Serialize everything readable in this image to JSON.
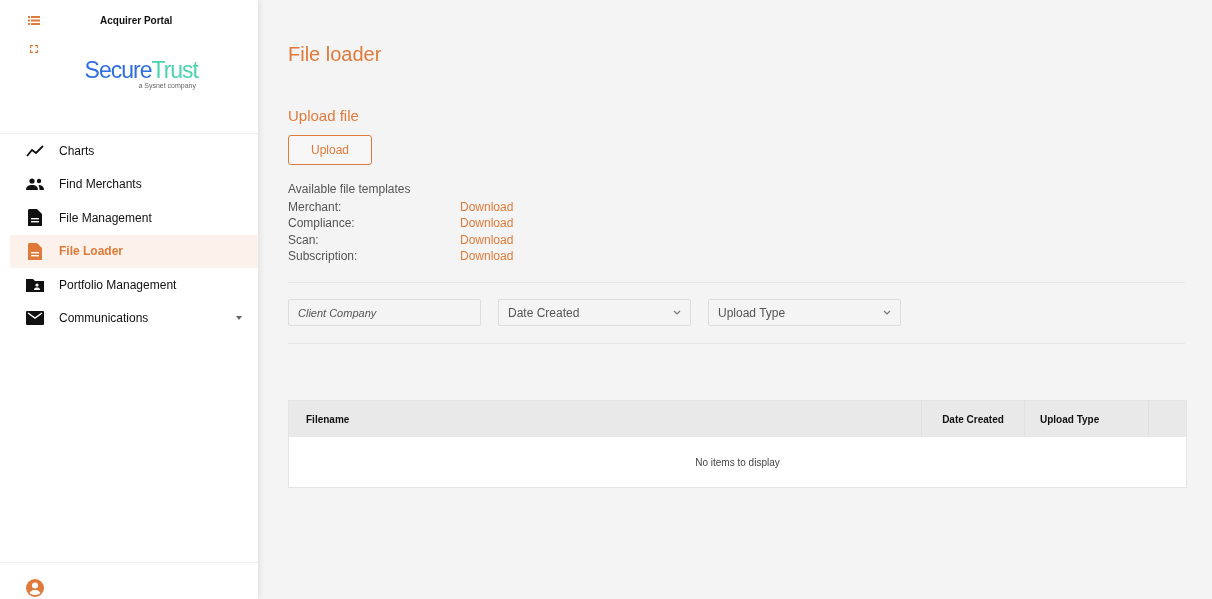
{
  "app": {
    "title": "Acquirer Portal"
  },
  "logo": {
    "primary": "Secure",
    "secondary": "Trust",
    "tagline": "a Sysnet company"
  },
  "sidebar": {
    "items": [
      {
        "label": "Charts",
        "selected": false,
        "expandable": false
      },
      {
        "label": "Find Merchants",
        "selected": false,
        "expandable": false
      },
      {
        "label": "File Management",
        "selected": false,
        "expandable": false
      },
      {
        "label": "File Loader",
        "selected": true,
        "expandable": false
      },
      {
        "label": "Portfolio Management",
        "selected": false,
        "expandable": false
      },
      {
        "label": "Communications",
        "selected": false,
        "expandable": true
      }
    ]
  },
  "page": {
    "title": "File loader",
    "upload_heading": "Upload file",
    "upload_button": "Upload",
    "templates_heading": "Available file templates",
    "templates": [
      {
        "name": "Merchant:",
        "link": "Download"
      },
      {
        "name": "Compliance:",
        "link": "Download"
      },
      {
        "name": "Scan:",
        "link": "Download"
      },
      {
        "name": "Subscription:",
        "link": "Download"
      }
    ]
  },
  "filters": [
    {
      "kind": "text",
      "placeholder": "Client Company"
    },
    {
      "kind": "select",
      "placeholder": "Date Created"
    },
    {
      "kind": "select",
      "placeholder": "Upload Type"
    }
  ],
  "table": {
    "columns": [
      "Filename",
      "Date Created",
      "Upload Type"
    ],
    "empty_message": "No items to display"
  }
}
